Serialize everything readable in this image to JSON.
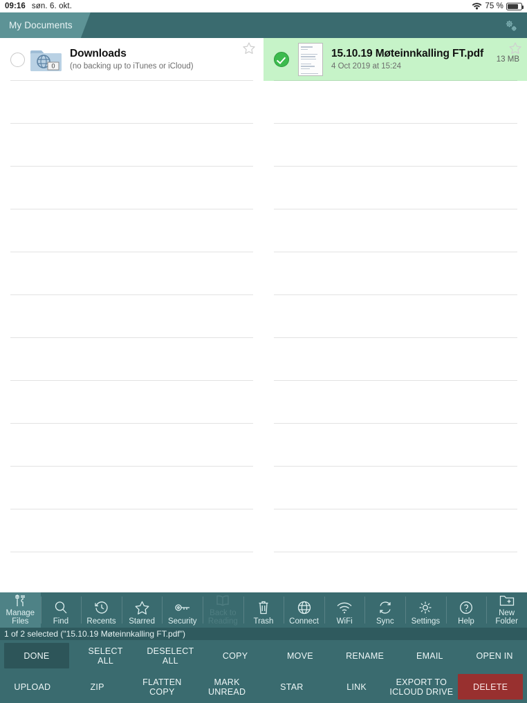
{
  "statusbar": {
    "time": "09:16",
    "date": "søn. 6. okt.",
    "wifi_icon": "wifi-icon",
    "battery_percent": "75 %",
    "battery_icon": "battery-icon"
  },
  "tabbar": {
    "tabs": [
      {
        "label": "My Documents"
      }
    ],
    "settings_icon": "gears-icon"
  },
  "file_list": {
    "left": {
      "items": [
        {
          "name": "Downloads",
          "subtitle": "(no backing up to iTunes or iCloud)",
          "icon": "folder-globe-icon",
          "badge": "0",
          "selected": false,
          "star_icon": "star-outline-icon",
          "size": ""
        }
      ],
      "empty_rows": 12
    },
    "right": {
      "items": [
        {
          "name": "15.10.19 Møteinnkalling FT.pdf",
          "subtitle": "4 Oct 2019 at 15:24",
          "icon": "pdf-document-icon",
          "size": "13 MB",
          "selected": true,
          "star_icon": "star-outline-icon",
          "check_icon": "check-circle-icon"
        }
      ],
      "empty_rows": 12
    }
  },
  "toolbar": {
    "items": [
      {
        "label": "Manage\nFiles",
        "icon": "tools-icon",
        "state": "active"
      },
      {
        "label": "Find",
        "icon": "search-icon",
        "state": "normal"
      },
      {
        "label": "Recents",
        "icon": "clock-back-icon",
        "state": "normal"
      },
      {
        "label": "Starred",
        "icon": "star-icon",
        "state": "normal"
      },
      {
        "label": "Security",
        "icon": "key-icon",
        "state": "normal"
      },
      {
        "label": "Back to\nReading",
        "icon": "book-icon",
        "state": "disabled"
      },
      {
        "label": "Trash",
        "icon": "trash-icon",
        "state": "normal"
      },
      {
        "label": "Connect",
        "icon": "globe-icon",
        "state": "normal"
      },
      {
        "label": "WiFi",
        "icon": "wifi-icon",
        "state": "normal"
      },
      {
        "label": "Sync",
        "icon": "sync-icon",
        "state": "normal"
      },
      {
        "label": "Settings",
        "icon": "gear-icon",
        "state": "normal"
      },
      {
        "label": "Help",
        "icon": "question-circle-icon",
        "state": "normal"
      },
      {
        "label": "New\nFolder",
        "icon": "new-folder-icon",
        "state": "normal"
      }
    ]
  },
  "statusline": {
    "text": "1 of 2 selected (\"15.10.19 Møteinnkalling FT.pdf\")"
  },
  "actions": {
    "row1": [
      {
        "label": "DONE",
        "style": "boxed"
      },
      {
        "label": "SELECT\nALL",
        "style": "plain"
      },
      {
        "label": "DESELECT\nALL",
        "style": "plain"
      },
      {
        "label": "COPY",
        "style": "plain"
      },
      {
        "label": "MOVE",
        "style": "plain"
      },
      {
        "label": "RENAME",
        "style": "plain"
      },
      {
        "label": "EMAIL",
        "style": "plain"
      },
      {
        "label": "OPEN IN",
        "style": "plain"
      }
    ],
    "row2": [
      {
        "label": "UPLOAD",
        "style": "plain"
      },
      {
        "label": "ZIP",
        "style": "plain"
      },
      {
        "label": "FLATTEN\nCOPY",
        "style": "plain"
      },
      {
        "label": "MARK\nUNREAD",
        "style": "plain"
      },
      {
        "label": "STAR",
        "style": "plain"
      },
      {
        "label": "LINK",
        "style": "plain"
      },
      {
        "label": "EXPORT TO\nICLOUD DRIVE",
        "style": "plain"
      },
      {
        "label": "DELETE",
        "style": "danger"
      }
    ]
  },
  "colors": {
    "chrome": "#3a6b6f",
    "tab_active": "#5d9396",
    "selected_row": "#c6f3c8",
    "danger": "#98302f",
    "check_green": "#3cbb4e"
  }
}
